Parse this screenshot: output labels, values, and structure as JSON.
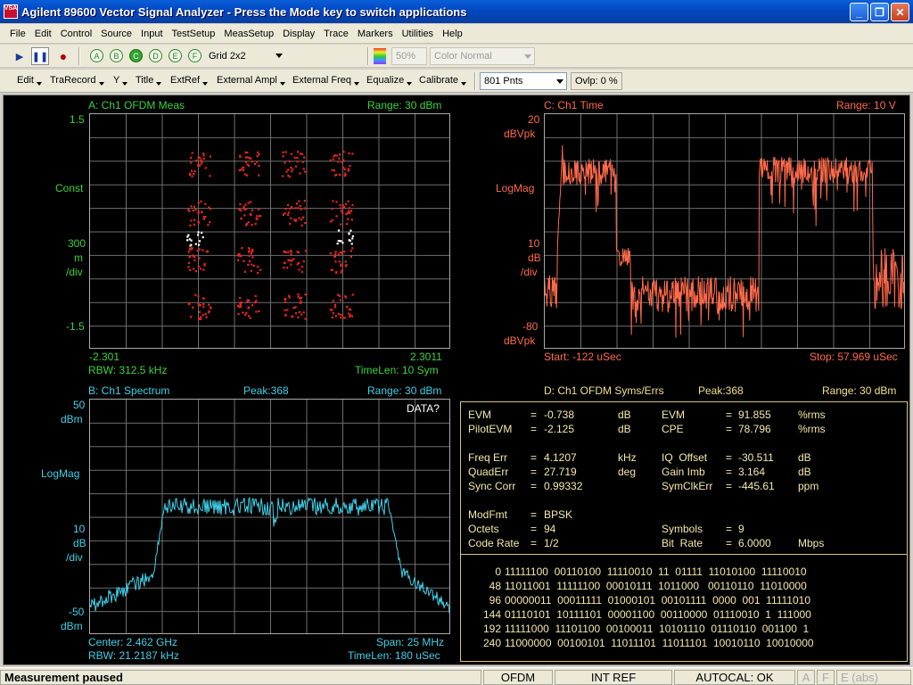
{
  "window": {
    "title": "Agilent 89600 Vector Signal Analyzer - Press the Mode key to switch applications",
    "icon_text": "VSA"
  },
  "menu": [
    "File",
    "Edit",
    "Control",
    "Source",
    "Input",
    "TestSetup",
    "MeasSetup",
    "Display",
    "Trace",
    "Markers",
    "Utilities",
    "Help"
  ],
  "toolbar1": {
    "traces": [
      "A",
      "B",
      "C",
      "D",
      "E",
      "F"
    ],
    "layout": "Grid 2x2",
    "percent": "50%",
    "color_mode": "Color Normal"
  },
  "toolbar2": {
    "items": [
      "Edit",
      "TraRecord",
      "Y",
      "Title",
      "ExtRef",
      "External Ampl",
      "External Freq",
      "Equalize",
      "Calibrate"
    ],
    "points": "801 Pnts",
    "overlap": "Ovlp: 0 %"
  },
  "panelA": {
    "title": "A: Ch1 OFDM Meas",
    "range": "Range: 30 dBm",
    "y_top": "1.5",
    "y_mid1": "Const",
    "y_scale": [
      "300",
      "m",
      "/div"
    ],
    "y_bottom": "-1.5",
    "x_left": "-2.301",
    "x_right": "2.3011",
    "footer_left": "RBW: 312.5 kHz",
    "footer_right": "TimeLen: 10  Sym"
  },
  "panelB": {
    "title": "B: Ch1 Spectrum",
    "peak": "Peak:368",
    "range": "Range: 30 dBm",
    "flag": "DATA?",
    "y_top": "50",
    "y_top_unit": "dBm",
    "y_mid": "LogMag",
    "y_scale": [
      "10",
      "dB",
      "/div"
    ],
    "y_bottom": "-50",
    "y_bottom_unit": "dBm",
    "footer_l1": "Center: 2.462 GHz",
    "footer_r1": "Span: 25 MHz",
    "footer_l2": "RBW: 21.2187 kHz",
    "footer_r2": "TimeLen: 180 uSec"
  },
  "panelC": {
    "title": "C: Ch1 Time",
    "range": "Range: 10  V",
    "y_top": "20",
    "y_top_unit": "dBVpk",
    "y_mid": "LogMag",
    "y_scale": [
      "10",
      "dB",
      "/div"
    ],
    "y_bottom": "-80",
    "y_bottom_unit": "dBVpk",
    "footer_left": "Start: -122 uSec",
    "footer_right": "Stop: 57.969 uSec"
  },
  "panelD": {
    "title": "D: Ch1 OFDM Syms/Errs",
    "peak": "Peak:368",
    "range": "Range: 30 dBm",
    "left": [
      [
        "EVM",
        "=",
        "-0.738",
        "dB"
      ],
      [
        "PilotEVM",
        "=",
        "-2.125",
        "dB"
      ],
      [
        "",
        "",
        " ",
        ""
      ],
      [
        "Freq Err",
        "=",
        "4.1207",
        "kHz"
      ],
      [
        "QuadErr",
        "=",
        "27.719",
        "deg"
      ],
      [
        "Sync Corr",
        "=",
        "0.99332",
        ""
      ],
      [
        "",
        "",
        "",
        ""
      ],
      [
        "ModFmt",
        "=",
        "BPSK",
        ""
      ],
      [
        "Octets",
        "=",
        "94",
        ""
      ],
      [
        "Code Rate",
        "=",
        "1/2",
        ""
      ]
    ],
    "right": [
      [
        "EVM",
        "=",
        "91.855",
        "%rms"
      ],
      [
        "CPE",
        "=",
        "78.796",
        "%rms"
      ],
      [
        "",
        "",
        "",
        ""
      ],
      [
        "IQ  Offset",
        "=",
        "-30.511",
        "dB"
      ],
      [
        "Gain Imb",
        "=",
        "3.164",
        "dB"
      ],
      [
        "SymClkErr",
        "=",
        "-445.61",
        "ppm"
      ],
      [
        "",
        "",
        "",
        ""
      ],
      [
        "",
        "",
        "",
        ""
      ],
      [
        "Symbols",
        "=",
        "9",
        ""
      ],
      [
        "Bit  Rate",
        "=",
        "6.0000",
        "Mbps"
      ]
    ],
    "bits": [
      [
        "0",
        "11111100  00110100  11110010  11  01111  11010100  11110010"
      ],
      [
        "48",
        "11011001  11111100  00010111  1011000   00110110  11010000"
      ],
      [
        "96",
        "00000011  00011111  01000101  00101111  0000  001  11111010"
      ],
      [
        "144",
        "01110101  10111101  00001100  00110000  01110010  1  111000"
      ],
      [
        "192",
        "11111000  11101100  00100011  10101110  01110110  001100  1"
      ],
      [
        "240",
        "11000000  00100101  11011101  11011101  10010110  10010000"
      ]
    ]
  },
  "status": {
    "message": "Measurement paused",
    "mode": "OFDM",
    "ref": "INT REF",
    "autocal": "AUTOCAL: OK",
    "a": "A",
    "f": "F",
    "e": "E (abs)"
  },
  "colors": {
    "green": "#3cd23c",
    "red": "#ff6a4a",
    "cyan": "#3fd0e8",
    "yellow": "#f4e8a8"
  }
}
